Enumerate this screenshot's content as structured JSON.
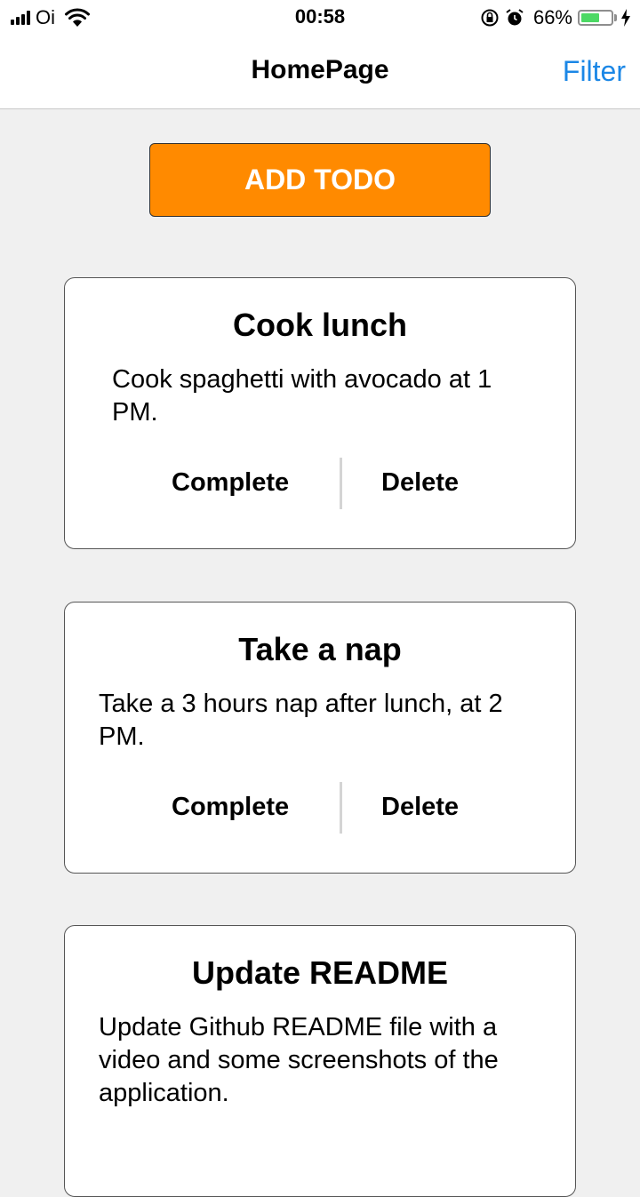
{
  "status_bar": {
    "carrier": "Oi",
    "time": "00:58",
    "battery_percent_label": "66%",
    "battery_level": 0.66,
    "battery_color": "#4cd964"
  },
  "nav": {
    "title": "HomePage",
    "filter_label": "Filter",
    "accent_color": "#1b87e6"
  },
  "add_button": {
    "label": "ADD TODO",
    "color": "#ff8a00"
  },
  "todos": [
    {
      "title": "Cook lunch",
      "description_lines": [
        "Cook spaghetti with avocado at 1",
        "PM."
      ],
      "complete_label": "Complete",
      "delete_label": "Delete"
    },
    {
      "title": "Take a nap",
      "description_lines": [
        "Take a 3 hours nap after lunch, at 2",
        "PM."
      ],
      "complete_label": "Complete",
      "delete_label": "Delete"
    },
    {
      "title": "Update README",
      "description_lines": [
        "Update Github README file with a",
        "video and some screenshots of the",
        "application."
      ]
    }
  ],
  "icons": [
    "signal-icon",
    "wifi-icon",
    "orientation-lock-icon",
    "alarm-icon",
    "battery-icon",
    "charging-bolt-icon"
  ]
}
